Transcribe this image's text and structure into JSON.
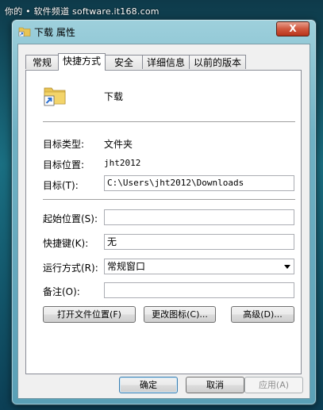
{
  "watermark": "你的 • 软件频道 software.it168.com",
  "window": {
    "title": "下载 属性",
    "close_glyph": "X"
  },
  "tabs": [
    {
      "label": "常规"
    },
    {
      "label": "快捷方式"
    },
    {
      "label": "安全"
    },
    {
      "label": "详细信息"
    },
    {
      "label": "以前的版本"
    }
  ],
  "shortcut": {
    "name": "下载",
    "target_type_label": "目标类型:",
    "target_type_value": "文件夹",
    "target_location_label": "目标位置:",
    "target_location_value": "jht2012",
    "target_label": "目标(T):",
    "target_value": "C:\\Users\\jht2012\\Downloads",
    "start_in_label": "起始位置(S):",
    "start_in_value": "",
    "hotkey_label": "快捷键(K):",
    "hotkey_value": "无",
    "run_label": "运行方式(R):",
    "run_value": "常规窗口",
    "comment_label": "备注(O):",
    "comment_value": "",
    "open_location_button": "打开文件位置(F)",
    "change_icon_button": "更改图标(C)...",
    "advanced_button": "高级(D)..."
  },
  "footer": {
    "ok": "确定",
    "cancel": "取消",
    "apply": "应用(A)"
  },
  "colors": {
    "folder": "#e8c454",
    "shortcut_arrow": "#2a6fd1"
  }
}
